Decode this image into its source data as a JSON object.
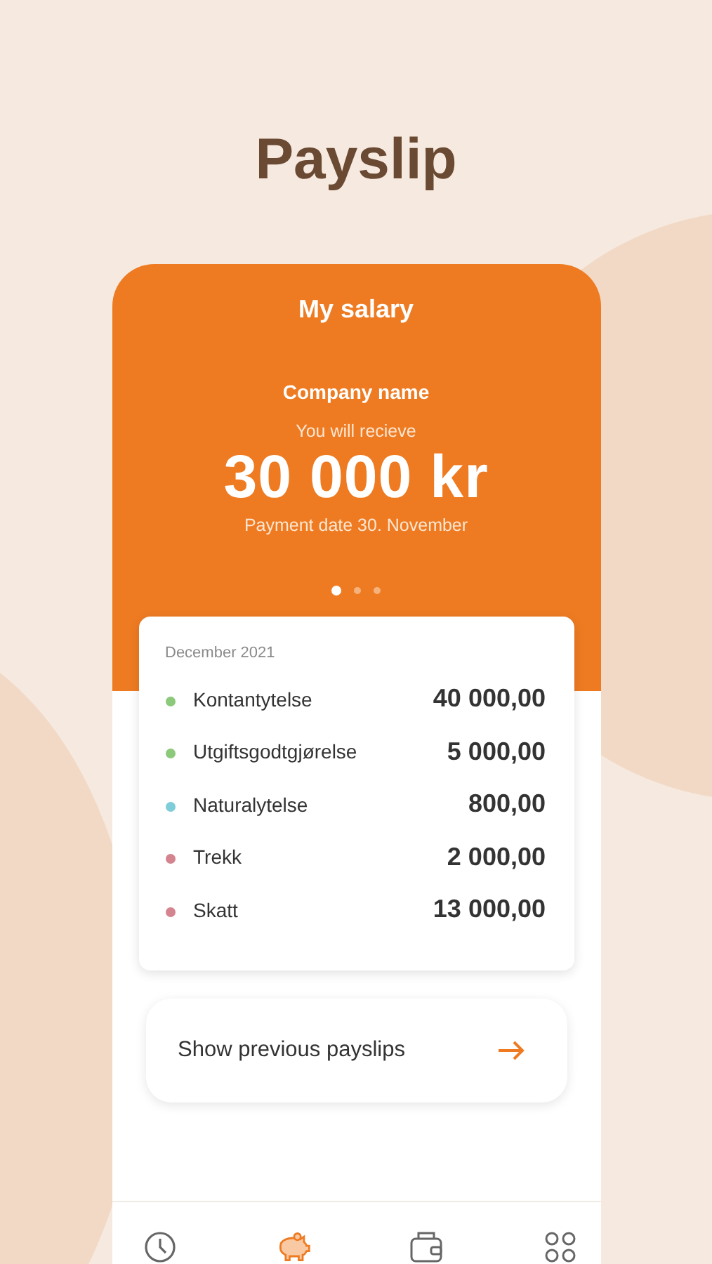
{
  "title": "Payslip",
  "salary_card": {
    "heading": "My salary",
    "company": "Company name",
    "caption": "You will recieve",
    "amount": "30 000 kr",
    "payment_date": "Payment date 30. November",
    "pages": [
      {
        "selected": true
      },
      {
        "selected": false
      },
      {
        "selected": false
      }
    ]
  },
  "breakdown": {
    "period": "December 2021",
    "items": [
      {
        "label": "Kontantytelse",
        "amount": "40 000,00",
        "color": "#8cc97a"
      },
      {
        "label": "Utgiftsgodtgjørelse",
        "amount": "5 000,00",
        "color": "#8cc97a"
      },
      {
        "label": "Naturalytelse",
        "amount": "800,00",
        "color": "#7fcdd8"
      },
      {
        "label": "Trekk",
        "amount": "2 000,00",
        "color": "#d4848e"
      },
      {
        "label": "Skatt",
        "amount": "13 000,00",
        "color": "#d4848e"
      }
    ]
  },
  "previous_button": {
    "label": "Show previous payslips"
  },
  "nav": [
    {
      "kind": "clock",
      "selected": false
    },
    {
      "kind": "piggy",
      "selected": true
    },
    {
      "kind": "wallet",
      "selected": false
    },
    {
      "kind": "apps",
      "selected": false
    }
  ]
}
